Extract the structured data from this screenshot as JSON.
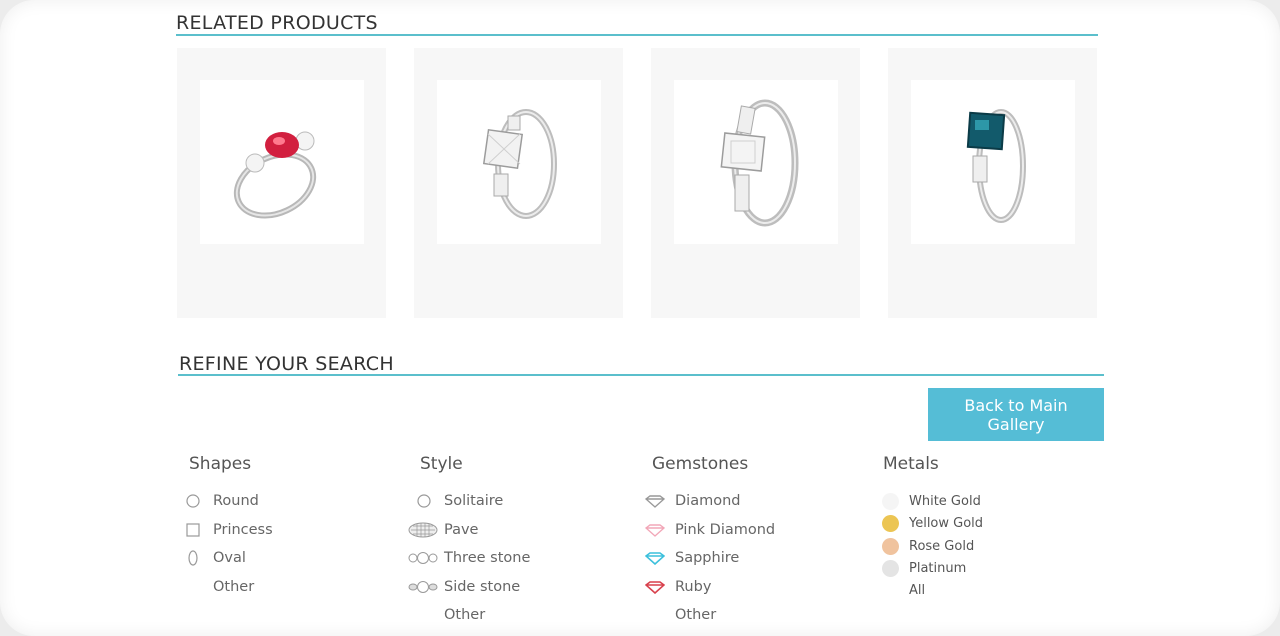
{
  "related": {
    "title": "RELATED PRODUCTS",
    "products": [
      {
        "name": "ruby-three-stone-ring",
        "image": "ruby-ring-icon"
      },
      {
        "name": "princess-diamond-ring",
        "image": "princess-ring-icon"
      },
      {
        "name": "emerald-cut-diamond-ring",
        "image": "emerald-ring-icon"
      },
      {
        "name": "teal-sapphire-ring",
        "image": "teal-ring-icon"
      }
    ]
  },
  "refine": {
    "title": "REFINE YOUR SEARCH",
    "back_button": "Back to Main Gallery",
    "shapes": {
      "title": "Shapes",
      "items": [
        {
          "label": "Round",
          "icon": "circle-outline-icon"
        },
        {
          "label": "Princess",
          "icon": "square-outline-icon"
        },
        {
          "label": "Oval",
          "icon": "oval-outline-icon"
        },
        {
          "label": "Other",
          "icon": ""
        }
      ]
    },
    "style": {
      "title": "Style",
      "items": [
        {
          "label": "Solitaire",
          "icon": "solitaire-icon"
        },
        {
          "label": "Pave",
          "icon": "pave-icon"
        },
        {
          "label": "Three stone",
          "icon": "three-stone-icon"
        },
        {
          "label": "Side stone",
          "icon": "side-stone-icon"
        },
        {
          "label": "Other",
          "icon": ""
        }
      ]
    },
    "gemstones": {
      "title": "Gemstones",
      "items": [
        {
          "label": "Diamond",
          "icon": "gem-icon",
          "color": "#999999"
        },
        {
          "label": "Pink Diamond",
          "icon": "gem-icon",
          "color": "#f2a7b8"
        },
        {
          "label": "Sapphire",
          "icon": "gem-icon",
          "color": "#3cc0dc"
        },
        {
          "label": "Ruby",
          "icon": "gem-icon",
          "color": "#d8414d"
        },
        {
          "label": "Other",
          "icon": ""
        }
      ]
    },
    "metals": {
      "title": "Metals",
      "items": [
        {
          "label": "White Gold",
          "color": "#f5f5f5"
        },
        {
          "label": "Yellow Gold",
          "color": "#ecc553"
        },
        {
          "label": "Rose Gold",
          "color": "#f0c39e"
        },
        {
          "label": "Platinum",
          "color": "#e4e4e4"
        },
        {
          "label": "All",
          "color": ""
        }
      ]
    }
  },
  "colors": {
    "accent": "#5bbfcc",
    "button": "#55bdd6"
  }
}
